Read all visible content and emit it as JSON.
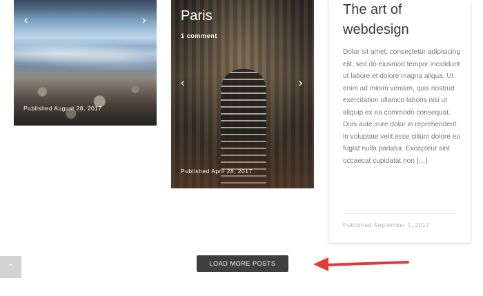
{
  "posts": [
    {
      "title": "",
      "comments": "",
      "published": "Published August 28, 2017"
    },
    {
      "title": "Paris",
      "comments": "1 comment",
      "published": "Published April 28, 2017"
    },
    {
      "title": "The art of webdesign",
      "excerpt": "Dolor sit amet, consectetur adipisicing elit, sed do eiusmod tempor incididunt ut labore et dolore magna aliqua. Ut enim ad minim veniam, quis nostrud exercitation ullamco laboris nisi ut aliquip ex ea commodo consequat. Duis aute irure dolor in reprehenderit in voluptate velit esse cillum dolore eu fugiat nulla pariatur. Excepteur sint occaecat cupidatat non […]",
      "published": "Published September 1, 2017"
    }
  ],
  "controls": {
    "prev_glyph": "‹",
    "next_glyph": "›",
    "load_more_label": "LOAD MORE POSTS",
    "scroll_top_glyph": "⌃"
  },
  "annotation": {
    "arrow_color": "#e53935"
  },
  "colors": {
    "button_bg": "#3f3f3f",
    "scroll_top_bg": "#d3d3d3"
  }
}
